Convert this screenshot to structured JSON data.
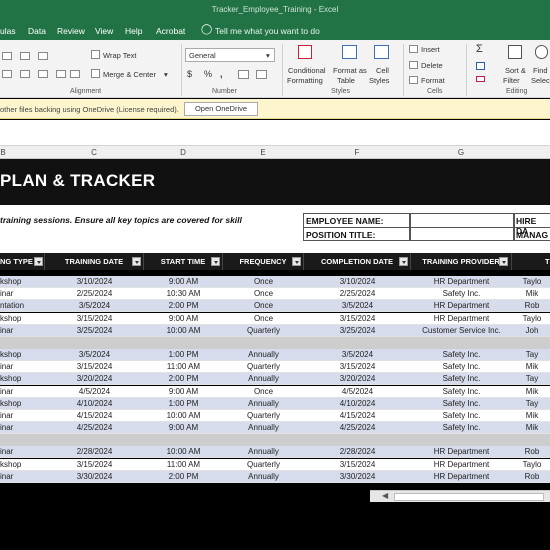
{
  "window": {
    "title": "Tracker_Employee_Training  -  Excel"
  },
  "menu": {
    "items": [
      "ulas",
      "Data",
      "Review",
      "View",
      "Help",
      "Acrobat"
    ],
    "tell_me": "Tell me what you want to do"
  },
  "ribbon": {
    "wrap_text": "Wrap Text",
    "merge_center": "Merge & Center",
    "number_format": "General",
    "conditional_formatting_1": "Conditional",
    "conditional_formatting_2": "Formatting",
    "format_as_table_1": "Format as",
    "format_as_table_2": "Table",
    "cell_styles_1": "Cell",
    "cell_styles_2": "Styles",
    "insert": "Insert",
    "delete": "Delete",
    "format": "Format",
    "sort_filter_1": "Sort &",
    "sort_filter_2": "Filter",
    "find_select_1": "Find",
    "find_select_2": "Select",
    "group_alignment": "Alignment",
    "group_number": "Number",
    "group_styles": "Styles",
    "group_cells": "Cells",
    "group_editing": "Editing",
    "sigma": "Σ",
    "percent": "%",
    "dollar": "$",
    "comma": ","
  },
  "message_bar": {
    "text": "other files backing using OneDrive (License required).",
    "button": "Open OneDrive"
  },
  "columns": [
    "B",
    "C",
    "D",
    "E",
    "F",
    "G"
  ],
  "sheet": {
    "title": "PLAN & TRACKER",
    "instructions": "training sessions. Ensure all key topics are covered for skill",
    "employee_name_label": "EMPLOYEE NAME:",
    "position_title_label": "POSITION TITLE:",
    "hire_date_label": "HIRE DA",
    "manager_label": "MANAG"
  },
  "table": {
    "headers": [
      "NG TYPE",
      "TRAINING DATE",
      "START TIME",
      "FREQUENCY",
      "COMPLETION DATE",
      "TRAINING PROVIDER",
      "TR"
    ],
    "groups": [
      [
        [
          "kshop",
          "3/10/2024",
          "9:00 AM",
          "Once",
          "3/10/2024",
          "HR Department",
          "Taylo"
        ],
        [
          "inar",
          "2/25/2024",
          "10:30 AM",
          "Once",
          "2/25/2024",
          "Safety Inc.",
          "Mik"
        ],
        [
          "ntation",
          "3/5/2024",
          "2:00 PM",
          "Once",
          "3/5/2024",
          "HR Department",
          "Rob"
        ],
        [
          "kshop",
          "3/15/2024",
          "9:00 AM",
          "Once",
          "3/15/2024",
          "HR Department",
          "Taylo"
        ],
        [
          "inar",
          "3/25/2024",
          "10:00 AM",
          "Quarterly",
          "3/25/2024",
          "Customer Service Inc.",
          "Joh"
        ]
      ],
      [
        [
          "kshop",
          "3/5/2024",
          "1:00 PM",
          "Annually",
          "3/5/2024",
          "Safety Inc.",
          "Tay"
        ],
        [
          "inar",
          "3/15/2024",
          "11:00 AM",
          "Quarterly",
          "3/15/2024",
          "Safety Inc.",
          "Mik"
        ],
        [
          "kshop",
          "3/20/2024",
          "2:00 PM",
          "Annually",
          "3/20/2024",
          "Safety Inc.",
          "Tay"
        ],
        [
          "inar",
          "4/5/2024",
          "9:00 AM",
          "Once",
          "4/5/2024",
          "Safety Inc.",
          "Mik"
        ],
        [
          "kshop",
          "4/10/2024",
          "1:00 PM",
          "Annually",
          "4/10/2024",
          "Safety Inc.",
          "Tay"
        ],
        [
          "inar",
          "4/15/2024",
          "10:00 AM",
          "Quarterly",
          "4/15/2024",
          "Safety Inc.",
          "Mik"
        ],
        [
          "inar",
          "4/25/2024",
          "9:00 AM",
          "Annually",
          "4/25/2024",
          "Safety Inc.",
          "Mik"
        ]
      ],
      [
        [
          "inar",
          "2/28/2024",
          "10:00 AM",
          "Annually",
          "2/28/2024",
          "HR Department",
          "Rob"
        ],
        [
          "kshop",
          "3/15/2024",
          "11:00 AM",
          "Quarterly",
          "3/15/2024",
          "HR Department",
          "Taylo"
        ],
        [
          "inar",
          "3/30/2024",
          "2:00 PM",
          "Annually",
          "3/30/2024",
          "HR Department",
          "Rob"
        ]
      ]
    ]
  },
  "colors": {
    "excel_green": "#217346",
    "row_band_blue": "#d6dcec",
    "row_band_white": "#ffffff",
    "header_dark": "#1a1a1a",
    "group_spacer": "#cdcdcd"
  }
}
